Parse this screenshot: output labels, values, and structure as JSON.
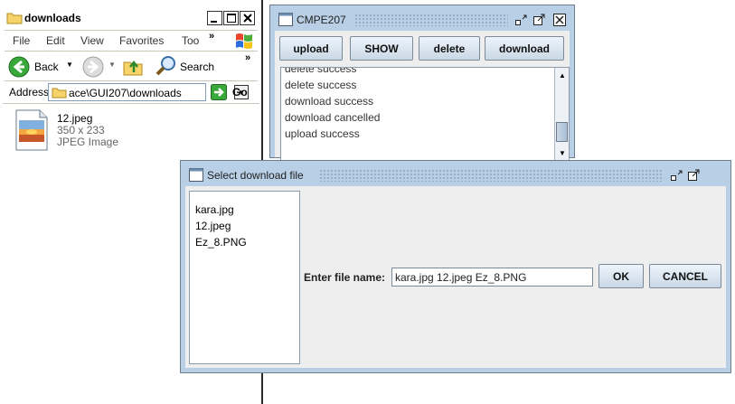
{
  "explorer": {
    "title": "downloads",
    "menu": [
      "File",
      "Edit",
      "View",
      "Favorites",
      "Too"
    ],
    "more_glyph": "»",
    "toolbar": {
      "back_label": "Back",
      "search_label": "Search"
    },
    "address": {
      "label": "Address",
      "value": "ace\\GUI207\\downloads",
      "go_label": "Go"
    },
    "file": {
      "name": "12.jpeg",
      "dimensions": "350 x 233",
      "type": "JPEG Image"
    }
  },
  "cmpe": {
    "title": "CMPE207",
    "buttons": [
      "upload",
      "SHOW",
      "delete",
      "download"
    ],
    "log": [
      "delete success",
      "delete success",
      "download success",
      "download cancelled",
      "upload success"
    ]
  },
  "dialog": {
    "title": "Select download file",
    "files": [
      "kara.jpg",
      "12.jpeg",
      "Ez_8.PNG"
    ],
    "input_label": "Enter file name:",
    "input_value": "kara.jpg 12.jpeg Ez_8.PNG",
    "ok_label": "OK",
    "cancel_label": "CANCEL"
  },
  "colors": {
    "java_frame": "#b8cfe5",
    "java_panel": "#eeeeee",
    "address_border": "#7f9db9"
  }
}
